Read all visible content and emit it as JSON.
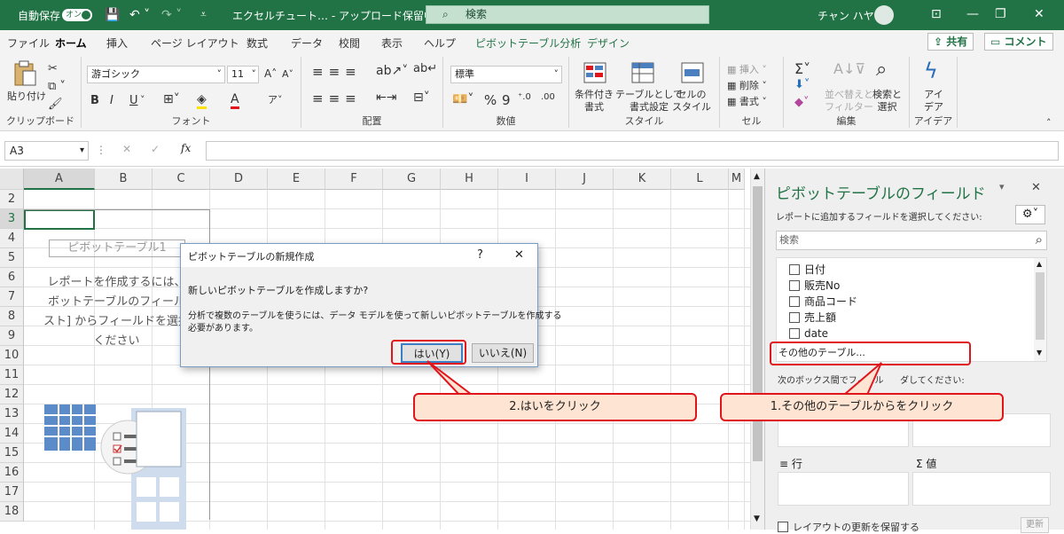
{
  "titlebar": {
    "autosave_label": "自動保存",
    "autosave_state": "オン",
    "doc_title": "エクセルチュート… - アップロード保留中",
    "search_placeholder": "検索",
    "user_name": "チャン ハヤミ"
  },
  "tabs": [
    "ファイル",
    "ホーム",
    "挿入",
    "ページ レイアウト",
    "数式",
    "データ",
    "校閲",
    "表示",
    "ヘルプ",
    "ピボットテーブル分析",
    "デザイン"
  ],
  "share_label": "共有",
  "comment_label": "コメント",
  "ribbon": {
    "clipboard": {
      "paste": "貼り付け",
      "label": "クリップボード"
    },
    "font": {
      "name": "游ゴシック",
      "size": "11",
      "label": "フォント",
      "bold": "B",
      "italic": "I",
      "underline": "U"
    },
    "align": {
      "label": "配置"
    },
    "number": {
      "format": "標準",
      "label": "数値"
    },
    "styles": {
      "cond": "条件付き\n書式",
      "table": "テーブルとして\n書式設定",
      "cell": "セルの\nスタイル",
      "label": "スタイル"
    },
    "cells": {
      "insert": "挿入",
      "delete": "削除",
      "format": "書式",
      "label": "セル"
    },
    "editing": {
      "sort": "並べ替えと\nフィルター",
      "find": "検索と\n選択",
      "label": "編集"
    },
    "ideas": {
      "btn": "アイ\nデア",
      "label": "アイデア"
    }
  },
  "formula_bar": {
    "cell_ref": "A3",
    "fx": "fx"
  },
  "sheet": {
    "columns": [
      "A",
      "B",
      "C",
      "D",
      "E",
      "F",
      "G",
      "H",
      "I",
      "J",
      "K",
      "L",
      "M"
    ],
    "rows": [
      "2",
      "3",
      "4",
      "5",
      "6",
      "7",
      "8",
      "9",
      "10",
      "11",
      "12",
      "13",
      "14",
      "15",
      "16",
      "17",
      "18"
    ],
    "pivot_name": "ピボットテーブル1",
    "pivot_msg": [
      "レポートを作成するには、",
      "ボットテーブルのフィール",
      "スト] からフィールドを選択",
      "ください"
    ]
  },
  "dialog": {
    "title": "ピボットテーブルの新規作成",
    "help": "?",
    "close": "✕",
    "question": "新しいピボットテーブルを作成しますか?",
    "desc1": "分析で複数のテーブルを使うには、データ モデルを使って新しいピボットテーブルを作成する",
    "desc2": "必要があります。",
    "yes": "はい(Y)",
    "no": "いいえ(N)"
  },
  "pane": {
    "title": "ピボットテーブルのフィールド",
    "subtitle": "レポートに追加するフィールドを選択してください:",
    "search": "検索",
    "fields": [
      "日付",
      "販売No",
      "商品コード",
      "売上額",
      "date"
    ],
    "other_tables": "その他のテーブル...",
    "drag_hint_a": "次のボックス間でフィール",
    "drag_hint_b": "ダしてください:",
    "rows_label": "行",
    "values_label": "値",
    "sigma": "Σ",
    "defer": "レイアウトの更新を保留する",
    "update": "更新"
  },
  "callouts": {
    "c1": "1.その他のテーブルからをクリック",
    "c2": "2.はいをクリック"
  },
  "colors": {
    "excel_green": "#217346",
    "callout_red": "#e0161c",
    "callout_fill": "#fde4d3"
  }
}
